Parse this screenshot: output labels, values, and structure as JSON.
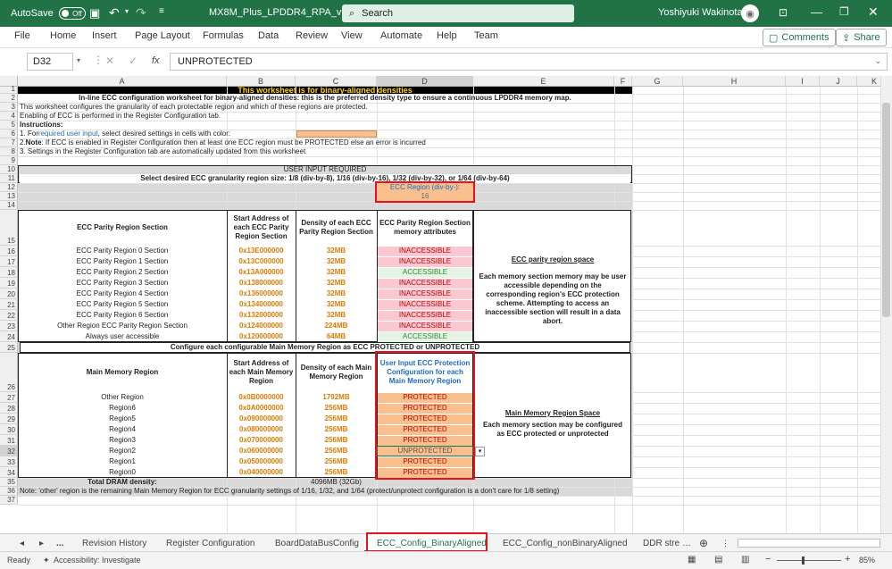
{
  "titlebar": {
    "autosave_label": "AutoSave",
    "autosave_state": "Off",
    "filename": "MX8M_Plus_LPDDR4_RPA_v9...",
    "search_placeholder": "Search",
    "user_name": "Yoshiyuki Wakinotani",
    "accent": "#217346"
  },
  "menu": {
    "items": [
      "File",
      "Home",
      "Insert",
      "Page Layout",
      "Formulas",
      "Data",
      "Review",
      "View",
      "Automate",
      "Help",
      "Team"
    ],
    "comments_label": "Comments",
    "share_label": "Share"
  },
  "formula_bar": {
    "name_box": "D32",
    "fx": "fx",
    "value": "UNPROTECTED"
  },
  "columns": [
    "A",
    "B",
    "C",
    "D",
    "E",
    "F",
    "G",
    "H",
    "I",
    "J",
    "K"
  ],
  "rows": [
    "1",
    "2",
    "3",
    "4",
    "5",
    "6",
    "7",
    "8",
    "9",
    "10",
    "11",
    "12",
    "13",
    "14",
    "15",
    "16",
    "17",
    "18",
    "19",
    "20",
    "21",
    "22",
    "23",
    "24",
    "25",
    "26",
    "27",
    "28",
    "29",
    "30",
    "31",
    "32",
    "33",
    "34",
    "35",
    "36",
    "37"
  ],
  "sheet": {
    "banner": "This worksheet is for binary-aligned densities",
    "r2": "In-line ECC configuration worksheet for binary-aligned densities: this is the preferred density type to ensure a continuous LPDDR4 memory map.",
    "r3": "This worksheet configures the granularity of each protectable region and which of these regions are protected.",
    "r4": "Enabling of ECC is performed in the Register Configuration tab.",
    "r5": "Instructions:",
    "r6_pre": "1. For ",
    "r6_link": "required user input",
    "r6_post": ", select desired settings in cells with color:",
    "r7_bold": "Note",
    "r7_pre": "2. ",
    "r7_post": ": If ECC is enabled in Register Configuration then at least one ECC region must be PROTECTED else an error is incurred",
    "r8": "3. Settings in the Register Configuration tab are automatically updated from this worksheet",
    "r10": "USER INPUT REQUIRED",
    "r11": "Select desired ECC granularity region size: 1/8 (div-by-8), 1/16 (div-by-16), 1/32 (div-by-32), or 1/64 (div-by-64)",
    "ecc_region_label": "ECC Region (div-by-):",
    "ecc_region_value": "16",
    "parity_header": {
      "section": "ECC Parity Region Section",
      "start": "Start Address of each ECC Parity Region Section",
      "density": "Density of each ECC Parity Region Section",
      "attr": "ECC Parity Region Section memory attributes"
    },
    "parity_rows": [
      {
        "name": "ECC Parity Region 0 Section",
        "addr": "0x13E000000",
        "size": "32MB",
        "attr": "INACCESSIBLE"
      },
      {
        "name": "ECC Parity Region 1 Section",
        "addr": "0x13C000000",
        "size": "32MB",
        "attr": "INACCESSIBLE"
      },
      {
        "name": "ECC Parity Region 2 Section",
        "addr": "0x13A000000",
        "size": "32MB",
        "attr": "ACCESSIBLE"
      },
      {
        "name": "ECC Parity Region 3 Section",
        "addr": "0x138000000",
        "size": "32MB",
        "attr": "INACCESSIBLE"
      },
      {
        "name": "ECC Parity Region 4 Section",
        "addr": "0x136000000",
        "size": "32MB",
        "attr": "INACCESSIBLE"
      },
      {
        "name": "ECC Parity Region 5 Section",
        "addr": "0x134000000",
        "size": "32MB",
        "attr": "INACCESSIBLE"
      },
      {
        "name": "ECC Parity Region 6 Section",
        "addr": "0x132000000",
        "size": "32MB",
        "attr": "INACCESSIBLE"
      },
      {
        "name": "Other Region ECC Parity Region Section",
        "addr": "0x124000000",
        "size": "224MB",
        "attr": "INACCESSIBLE"
      },
      {
        "name": "Always user accessible",
        "addr": "0x120000000",
        "size": "64MB",
        "attr": "ACCESSIBLE"
      }
    ],
    "parity_note_title": "ECC parity region space",
    "parity_note": "Each memory section memory may be user accessible depending on the corresponding region's ECC protection scheme. Attempting to access an inaccessible section will result in a data abort.",
    "r25": "Configure each configurable Main Memory Region as ECC PROTECTED or UNPROTECTED",
    "main_header": {
      "region": "Main Memory Region",
      "start": "Start Address of each Main Memory Region",
      "density": "Density of each Main Memory Region",
      "input": "User Input ECC Protection Configuration for each Main Memory Region"
    },
    "main_rows": [
      {
        "name": "Other Region",
        "addr": "0x0B0000000",
        "size": "1792MB",
        "cfg": "PROTECTED"
      },
      {
        "name": "Region6",
        "addr": "0x0A0000000",
        "size": "256MB",
        "cfg": "PROTECTED"
      },
      {
        "name": "Region5",
        "addr": "0x090000000",
        "size": "256MB",
        "cfg": "PROTECTED"
      },
      {
        "name": "Region4",
        "addr": "0x080000000",
        "size": "256MB",
        "cfg": "PROTECTED"
      },
      {
        "name": "Region3",
        "addr": "0x070000000",
        "size": "256MB",
        "cfg": "PROTECTED"
      },
      {
        "name": "Region2",
        "addr": "0x060000000",
        "size": "256MB",
        "cfg": "UNPROTECTED"
      },
      {
        "name": "Region1",
        "addr": "0x050000000",
        "size": "256MB",
        "cfg": "PROTECTED"
      },
      {
        "name": "Region0",
        "addr": "0x040000000",
        "size": "256MB",
        "cfg": "PROTECTED"
      }
    ],
    "main_note_title": "Main Memory Region Space",
    "main_note": "Each memory section may be configured as ECC protected or unprotected",
    "total_label": "Total DRAM density:",
    "total_value": "4096MB (32Gb)",
    "r36": "Note: 'other' region is the remaining Main Memory Region for ECC granularity settings of 1/16, 1/32, and 1/64 (protect/unprotect configuration is a don't care for 1/8 setting)"
  },
  "tabs": {
    "ellipsis": "...",
    "items": [
      "Revision History",
      "Register Configuration",
      "BoardDataBusConfig",
      "ECC_Config_BinaryAligned",
      "ECC_Config_nonBinaryAligned",
      "DDR stre"
    ]
  },
  "status": {
    "ready": "Ready",
    "accessibility": "Accessibility: Investigate",
    "zoom": "85%"
  }
}
